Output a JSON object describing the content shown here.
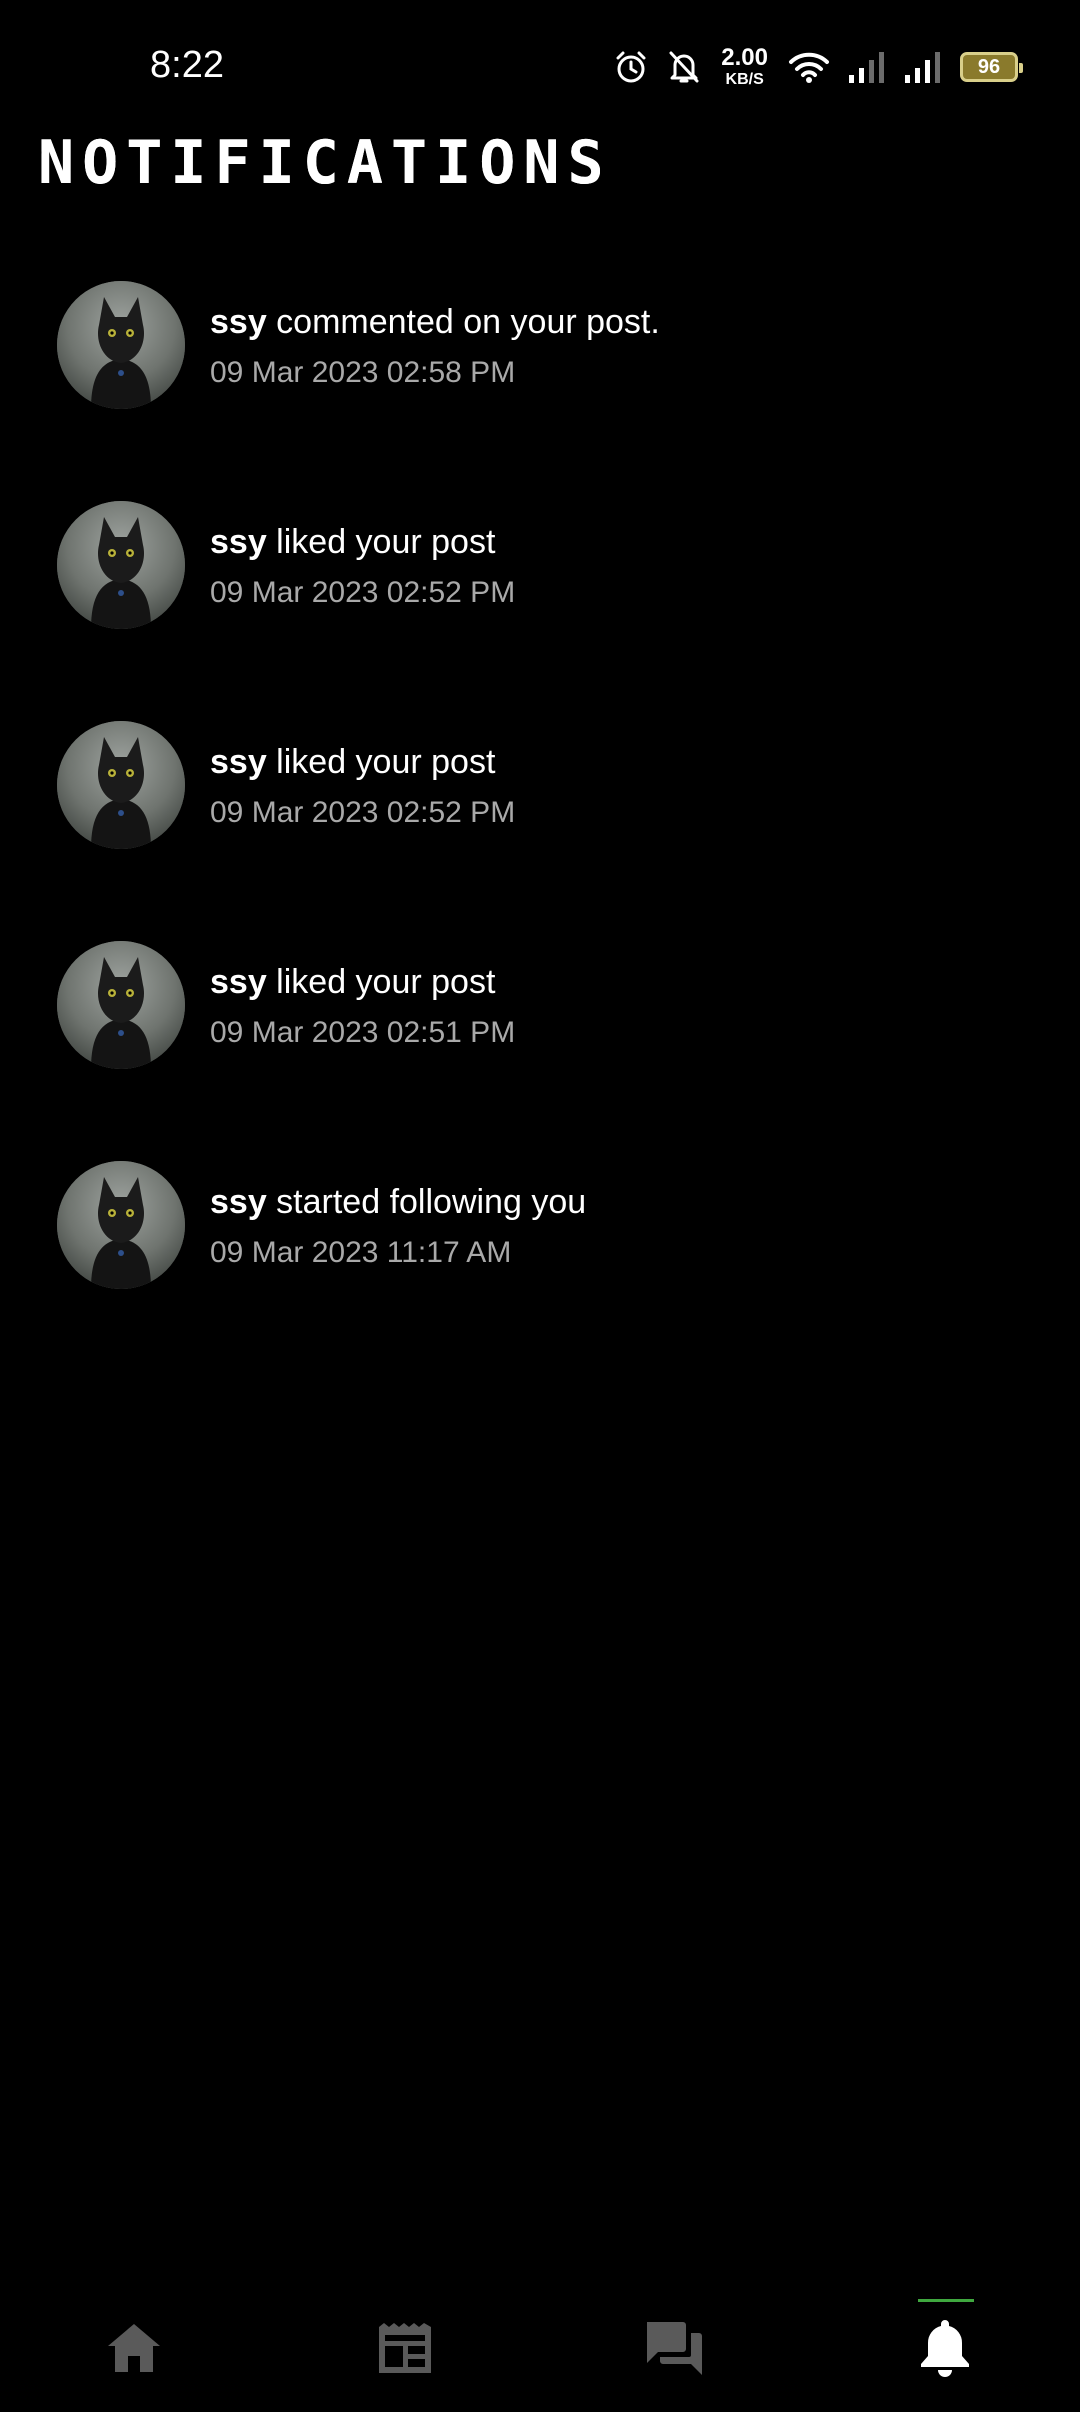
{
  "status_bar": {
    "time": "8:22",
    "net_speed_value": "2.00",
    "net_speed_unit": "KB/S",
    "battery": "96",
    "icons": [
      "alarm-icon",
      "bell-off-icon",
      "wifi-icon",
      "signal-icon",
      "signal-icon",
      "battery-icon"
    ]
  },
  "page": {
    "title": "NOTIFICATIONS"
  },
  "notifications": [
    {
      "user": "ssy",
      "action": " commented on your post.",
      "time": "09 Mar 2023 02:58 PM"
    },
    {
      "user": "ssy",
      "action": " liked your post",
      "time": "09 Mar 2023 02:52 PM"
    },
    {
      "user": "ssy",
      "action": " liked your post",
      "time": "09 Mar 2023 02:52 PM"
    },
    {
      "user": "ssy",
      "action": " liked your post",
      "time": "09 Mar 2023 02:51 PM"
    },
    {
      "user": "ssy",
      "action": " started following you",
      "time": "09 Mar 2023 11:17 AM"
    }
  ],
  "bottom_nav": {
    "items": [
      "home-icon",
      "feed-icon",
      "messages-icon",
      "notifications-icon"
    ],
    "active": "notifications-icon",
    "active_color": "#3fa83f",
    "icon_color": "#5a5a5a"
  }
}
